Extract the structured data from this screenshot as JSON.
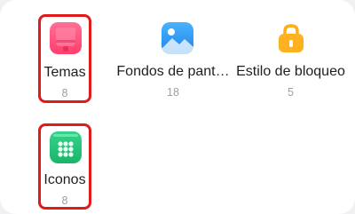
{
  "tiles": [
    {
      "label": "Temas",
      "count": "8",
      "icon": "bell-theme-icon",
      "highlighted": true
    },
    {
      "label": "Fondos de pant…",
      "count": "18",
      "icon": "wallpaper-image-icon",
      "highlighted": false
    },
    {
      "label": "Estilo de bloqueo",
      "count": "5",
      "icon": "lock-icon",
      "highlighted": false
    },
    {
      "label": "Iconos",
      "count": "8",
      "icon": "app-grid-icon",
      "highlighted": true
    }
  ],
  "colors": {
    "highlight_border": "#e01b1b",
    "temas_icon": "#ff4f7b",
    "fondos_icon": "#2e9bf0",
    "estilo_icon": "#ffae1a",
    "iconos_icon": "#21c27a"
  }
}
